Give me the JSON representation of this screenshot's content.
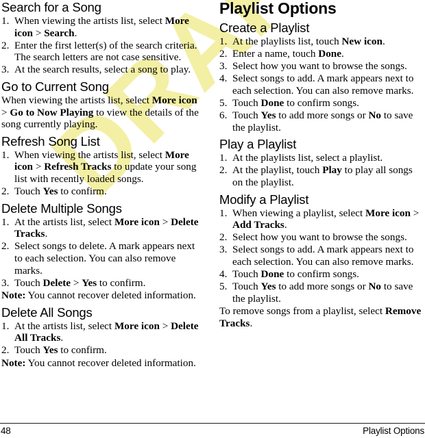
{
  "document": {
    "watermark_text": "DRAFT",
    "watermark_color": "#f3efa4"
  },
  "left_column": {
    "sections": [
      {
        "heading": "Search for a Song",
        "steps": [
          "When viewing the artists list, select <b>More icon</b> &gt; <b>Search</b>.",
          "Enter the first letter(s) of the search criteria. The search letters are not case sensitive.",
          "At the search results, select a song to play."
        ]
      },
      {
        "heading": "Go to Current Song",
        "paragraph": "When viewing the artists list, select <b>More icon</b> &gt; <b>Go to Now Playing</b> to view the details of the song currently playing."
      },
      {
        "heading": "Refresh Song List",
        "steps": [
          "When viewing the artists list, select <b>More icon</b> &gt; <b>Refresh Tracks</b> to update your song list with recently loaded songs.",
          "Touch <b>Yes</b> to confirm."
        ]
      },
      {
        "heading": "Delete Multiple Songs",
        "steps": [
          "At the artists list, select <b>More icon</b> &gt; <b>Delete Tracks</b>.",
          "Select songs to delete. A mark appears next to each selection. You can also remove marks.",
          "Touch <b>Delete</b> &gt; <b>Yes</b> to confirm."
        ],
        "note": "<b>Note:</b> You cannot recover deleted information."
      },
      {
        "heading": "Delete All Songs",
        "steps": [
          "At the artists list, select <b>More icon</b> &gt; <b>Delete All Tracks</b>.",
          "Touch <b>Yes</b> to confirm."
        ],
        "note": "<b>Note:</b> You cannot recover deleted information."
      }
    ]
  },
  "right_column": {
    "page_title": "Playlist Options",
    "sections": [
      {
        "heading": "Create a Playlist",
        "steps": [
          "At the playlists list, touch <b>New icon</b>.",
          "Enter a name, touch <b>Done</b>.",
          "Select how you want to browse the songs.",
          "Select songs to add. A mark appears next to each selection. You can also remove marks.",
          "Touch <b>Done</b> to confirm songs.",
          "Touch <b>Yes</b> to add more songs or <b>No</b> to save the playlist."
        ]
      },
      {
        "heading": "Play a Playlist",
        "steps": [
          "At the playlists list, select a playlist.",
          "At the playlist, touch <b>Play</b> to play all songs on the playlist."
        ]
      },
      {
        "heading": "Modify a Playlist",
        "steps": [
          "When viewing a playlist, select <b>More icon</b> &gt; <b>Add Tracks</b>.",
          "Select how you want to browse the songs.",
          "Select songs to add. A mark appears next to each selection. You can also remove marks.",
          "Touch <b>Done</b> to confirm songs.",
          "Touch <b>Yes</b> to add more songs or <b>No</b> to save the playlist."
        ],
        "note": "To remove songs from a playlist, select <b>Remove Tracks</b>."
      }
    ]
  },
  "footer": {
    "page_number": "48",
    "title": "Playlist Options"
  }
}
